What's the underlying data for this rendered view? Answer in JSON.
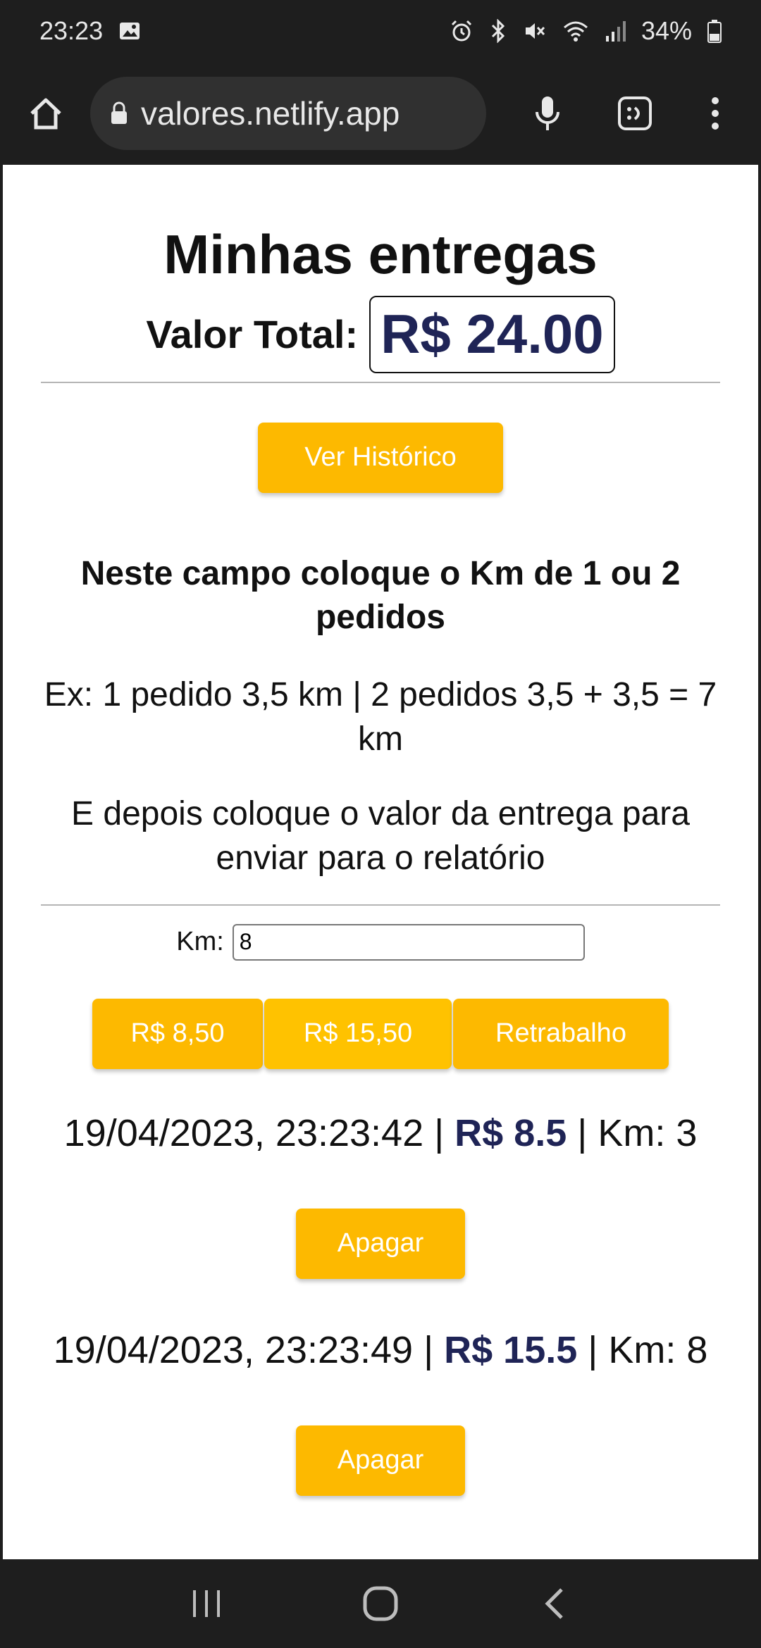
{
  "status_bar": {
    "time": "23:23",
    "battery": "34%",
    "icons": [
      "image-icon",
      "alarm-icon",
      "bluetooth-icon",
      "mute-icon",
      "wifi-icon",
      "signal-icon",
      "battery-icon"
    ]
  },
  "browser": {
    "url": "valores.netlify.app",
    "icons": [
      "home-icon",
      "lock-icon",
      "mic-icon",
      "tab-switcher-icon",
      "more-vert-icon"
    ]
  },
  "page": {
    "title": "Minhas entregas",
    "total_label": "Valor Total:",
    "total_value": "R$ 24.00",
    "history_button": "Ver Histórico",
    "instruction_bold": "Neste campo coloque o Km de 1 ou 2 pedidos",
    "instruction_example": "Ex: 1 pedido 3,5 km | 2 pedidos 3,5 + 3,5 = 7 km",
    "instruction_value": "E depois coloque o valor da entrega para enviar para o relatório",
    "km_label": "Km:",
    "km_value": "8",
    "value_buttons": [
      "R$ 8,50",
      "R$ 15,50",
      "Retrabalho"
    ],
    "entries": [
      {
        "datetime": "19/04/2023, 23:23:42",
        "sep1": " | ",
        "value": "R$ 8.5",
        "sep2": " | ",
        "km": "Km: 3",
        "delete_label": "Apagar"
      },
      {
        "datetime": "19/04/2023, 23:23:49",
        "sep1": " | ",
        "value": "R$ 15.5",
        "sep2": " | ",
        "km": "Km: 8",
        "delete_label": "Apagar"
      }
    ]
  },
  "colors": {
    "accent": "#fdb900",
    "value_text": "#1f2456",
    "chrome_bg": "#1e1e1e"
  },
  "nav_bar": {
    "icons": [
      "recents-icon",
      "home-nav-icon",
      "back-icon"
    ]
  }
}
